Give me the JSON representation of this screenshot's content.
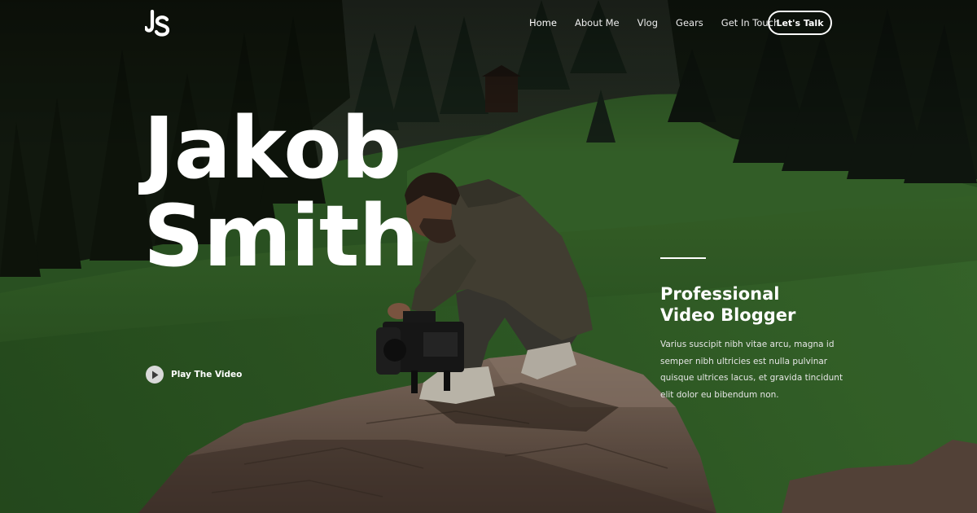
{
  "header": {
    "logo_text": "JS",
    "nav": [
      {
        "label": "Home",
        "active": true
      },
      {
        "label": "About Me",
        "active": false
      },
      {
        "label": "Vlog",
        "active": false
      },
      {
        "label": "Gears",
        "active": false
      },
      {
        "label": "Get In Touch",
        "active": false
      }
    ],
    "cta_label": "Let's Talk"
  },
  "hero": {
    "first_name": "Jakob",
    "last_name": "Smith",
    "play_label": "Play The Video",
    "play_icon": "play-icon",
    "role_line1": "Professional",
    "role_line2": "Video Blogger",
    "description": "Varius suscipit nibh vitae arcu, magna id semper nibh ultricies est nulla pulvinar quisque ultrices lacus, et gravida tincidunt elit dolor eu bibendum non."
  },
  "colors": {
    "text": "#ffffff",
    "grass": "#2f5a26",
    "forest": "#15200f",
    "rock": "#6e5a4d"
  }
}
